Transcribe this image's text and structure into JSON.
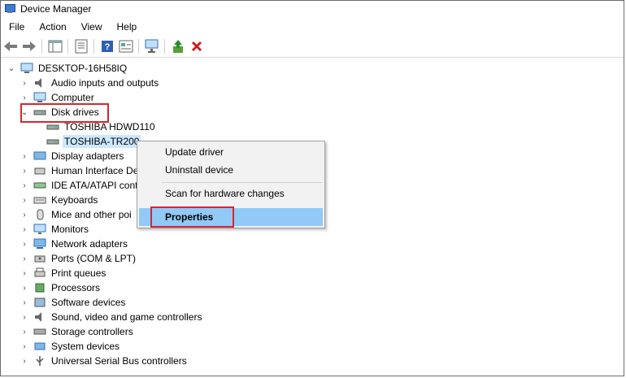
{
  "window": {
    "title": "Device Manager"
  },
  "menu": [
    "File",
    "Action",
    "View",
    "Help"
  ],
  "toolbar": {
    "buttons": [
      "back-icon",
      "forward-icon",
      "show-hide-tree-icon",
      "properties-icon",
      "help-icon",
      "view-icon",
      "scan-hardware-icon",
      "update-driver-icon",
      "uninstall-icon"
    ]
  },
  "tree": {
    "root": "DESKTOP-16H58IQ",
    "categories": [
      {
        "label": "Audio inputs and outputs"
      },
      {
        "label": "Computer"
      },
      {
        "label": "Disk drives",
        "expanded": true,
        "children": [
          "TOSHIBA HDWD110",
          "TOSHIBA-TR200"
        ]
      },
      {
        "label": "Display adapters"
      },
      {
        "label": "Human Interface De"
      },
      {
        "label": "IDE ATA/ATAPI cont"
      },
      {
        "label": "Keyboards"
      },
      {
        "label": "Mice and other poi"
      },
      {
        "label": "Monitors"
      },
      {
        "label": "Network adapters"
      },
      {
        "label": "Ports (COM & LPT)"
      },
      {
        "label": "Print queues"
      },
      {
        "label": "Processors"
      },
      {
        "label": "Software devices"
      },
      {
        "label": "Sound, video and game controllers"
      },
      {
        "label": "Storage controllers"
      },
      {
        "label": "System devices"
      },
      {
        "label": "Universal Serial Bus controllers"
      }
    ]
  },
  "context_menu": {
    "items": [
      "Update driver",
      "Uninstall device",
      "Scan for hardware changes",
      "Properties"
    ],
    "highlighted": "Properties"
  },
  "colors": {
    "highlight_box": "#d6262f",
    "selection": "#cce8ff",
    "menu_hover": "#91c9f7"
  }
}
